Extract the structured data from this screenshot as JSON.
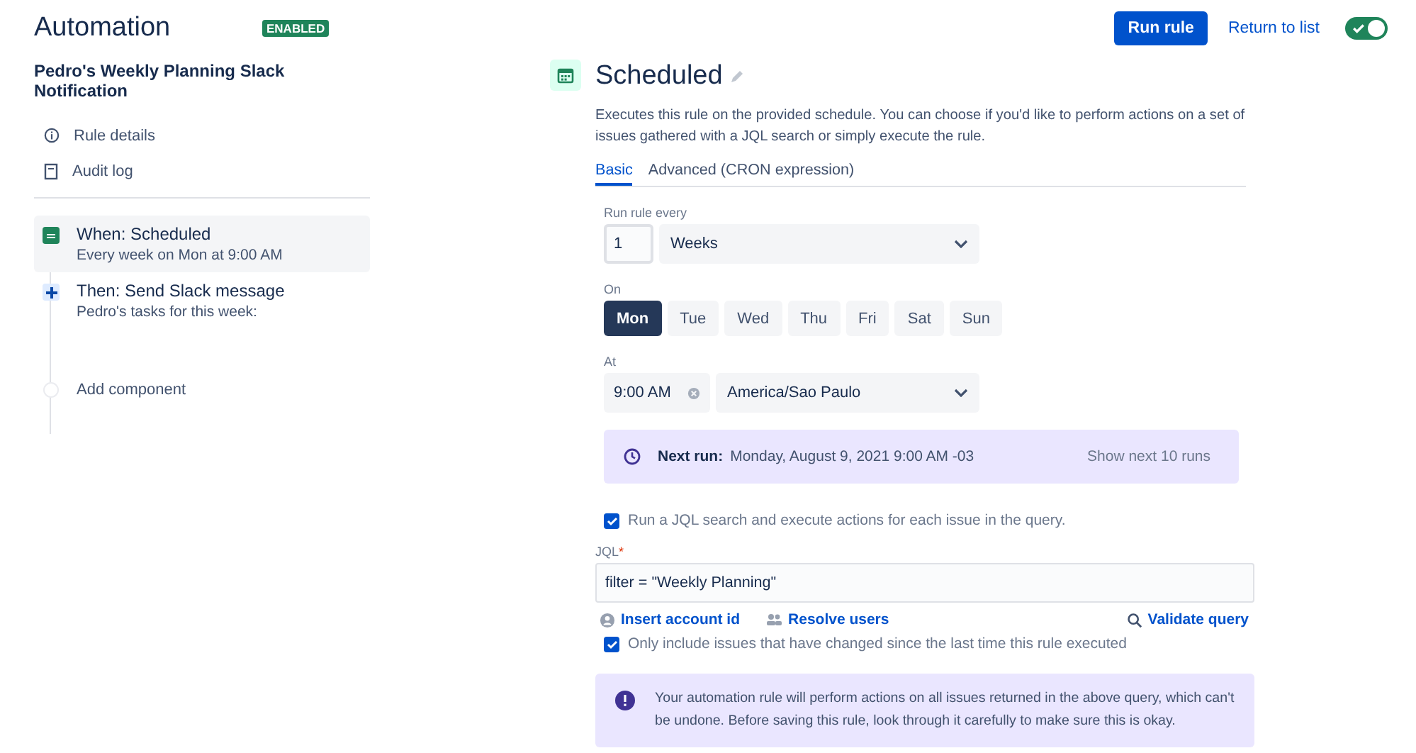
{
  "header": {
    "title": "Automation",
    "status": "ENABLED",
    "run_button": "Run rule",
    "return_link": "Return to list",
    "toggle": {
      "on": true
    }
  },
  "rule": {
    "name": "Pedro's Weekly Planning Slack Notification",
    "nav": [
      {
        "label": "Rule details",
        "kind": "info"
      },
      {
        "label": "Audit log",
        "kind": "document"
      }
    ],
    "components": [
      {
        "kind": "trigger",
        "title": "When: Scheduled",
        "subtitle": "Every week on Mon at 9:00 AM",
        "selected": true
      },
      {
        "kind": "action",
        "title": "Then: Send Slack message",
        "subtitle": "Pedro's tasks for this week:",
        "selected": false
      },
      {
        "kind": "add",
        "title": "Add component",
        "selected": false
      }
    ]
  },
  "panel": {
    "title": "Scheduled",
    "description": "Executes this rule on the provided schedule. You can choose if you'd like to perform actions on a set of issues gathered with a JQL search or simply execute the rule.",
    "tabs": [
      {
        "label": "Basic",
        "selected": true
      },
      {
        "label": "Advanced (CRON expression)",
        "selected": false
      }
    ],
    "run_every": {
      "label": "Run rule every",
      "count": "1",
      "unit": "Weeks"
    },
    "on": {
      "label": "On",
      "days": [
        {
          "label": "Mon",
          "selected": true
        },
        {
          "label": "Tue",
          "selected": false
        },
        {
          "label": "Wed",
          "selected": false
        },
        {
          "label": "Thu",
          "selected": false
        },
        {
          "label": "Fri",
          "selected": false
        },
        {
          "label": "Sat",
          "selected": false
        },
        {
          "label": "Sun",
          "selected": false
        }
      ]
    },
    "at": {
      "label": "At",
      "time": "9:00 AM",
      "timezone": "America/Sao Paulo"
    },
    "next_run": {
      "label": "Next run:",
      "value": "Monday, August 9, 2021 9:00 AM -03",
      "link": "Show next 10 runs"
    },
    "jql_search": {
      "label": "Run a JQL search and execute actions for each issue in the query.",
      "checked": true
    },
    "jql": {
      "label": "JQL",
      "required_mark": "*",
      "value": "filter = \"Weekly Planning\""
    },
    "jql_links": [
      {
        "label": "Insert account id",
        "kind": "person"
      },
      {
        "label": "Resolve users",
        "kind": "people"
      },
      {
        "label": "Validate query",
        "kind": "search"
      }
    ],
    "only_changed": {
      "label": "Only include issues that have changed since the last time this rule executed",
      "checked": true
    },
    "warning": "Your automation rule will perform actions on all issues returned in the above query, which can't be undone. Before saving this rule, look through it carefully to make sure this is okay."
  }
}
